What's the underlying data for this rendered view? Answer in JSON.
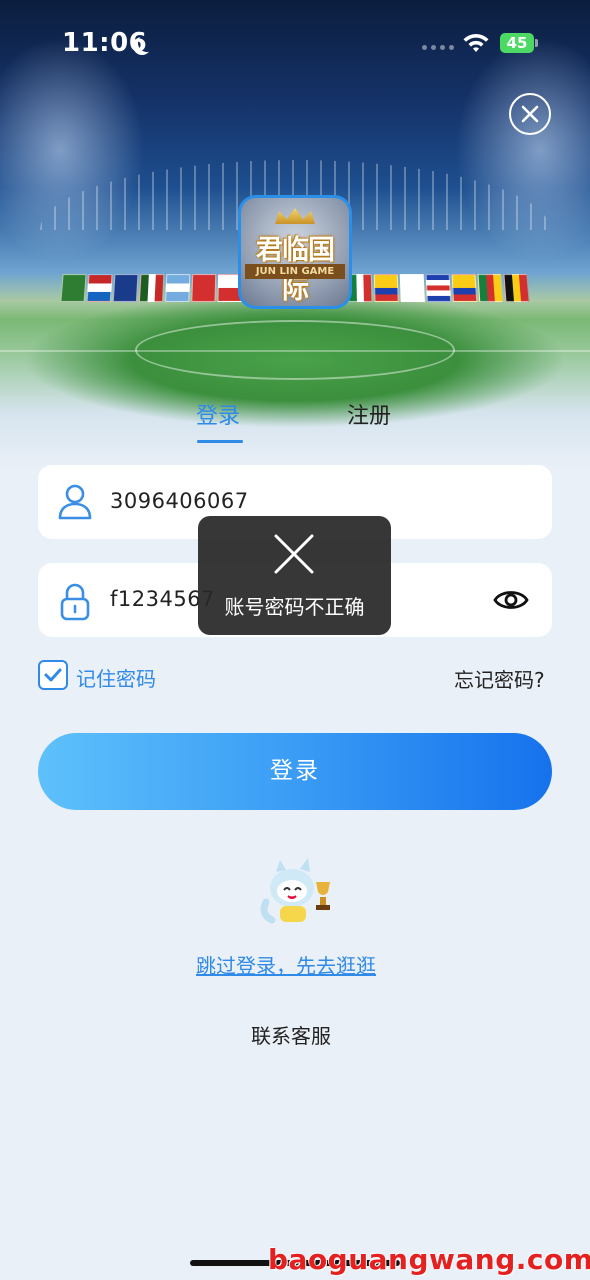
{
  "status_bar": {
    "time": "11:06",
    "battery": "45"
  },
  "logo": {
    "title": "君临国际",
    "subtitle": "JUN LIN GAME"
  },
  "tabs": [
    {
      "label": "登录",
      "active": true
    },
    {
      "label": "注册",
      "active": false
    }
  ],
  "form": {
    "username_value": "3096406067",
    "password_value": "f1234567",
    "remember_label": "记住密码",
    "remember_checked": true,
    "forgot_label": "忘记密码?",
    "login_label": "登录"
  },
  "toast": {
    "icon": "close-icon",
    "message": "账号密码不正确"
  },
  "links": {
    "skip": "跳过登录，先去逛逛",
    "service": "联系客服"
  },
  "watermark": "baoguangwang.com",
  "colors": {
    "accent": "#2f8ae8",
    "button_start": "#5ec1fb",
    "button_end": "#1672ec",
    "battery": "#4cd964"
  }
}
